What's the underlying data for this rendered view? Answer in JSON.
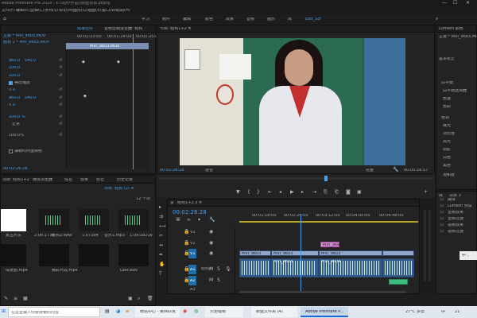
{
  "titlebar": {
    "text": "Adobe Premiere Pro 2020 - E:\\\\动作作品\\\\新建项目.prproj",
    "minimize": "—",
    "maximize": "☐",
    "close": "✕"
  },
  "menubar": [
    "文件(F)",
    "编辑(E)",
    "剪辑(C)",
    "序列(S)",
    "标记(M)",
    "图形(G)",
    "视图(V)",
    "窗口(W)",
    "帮助(H)"
  ],
  "workspaces": [
    "学习",
    "组件",
    "编辑",
    "颜色",
    "效果",
    "音频",
    "图形",
    "库",
    "Edit_Scr"
  ],
  "effect_controls": {
    "tabs": [
      "效果控件",
      "音频剪辑混合器: 结构"
    ],
    "source": "主要 * MVI_9603.MOV",
    "seq": "结构 1 * MVI_9603.MOV",
    "ruler": [
      "00:01:23:00",
      "00:01:24:00",
      "00:01:25:00"
    ],
    "clip_label": "MVI_9603.MOV",
    "values": [
      "960.0",
      "540.0",
      "100.0",
      "100.0",
      "0.0",
      "960.0",
      "540.0",
      "0.0"
    ],
    "uniform": "等比缩放",
    "opacity": "100.0 %",
    "blend": "正常",
    "speed": "100.0%",
    "checkbox": "抽帧时间重映射",
    "time": "00:02:26:28"
  },
  "program": {
    "title": "节目: 结构1+2 ≡",
    "time": "00:02:26:28",
    "fit": "适合",
    "quality": "完整",
    "duration": "00:05:16:57"
  },
  "lumetri": {
    "title": "Lumetri 颜色",
    "sub": "主要 * MVI_9603.MOV",
    "section": "基本校正",
    "items": [
      "白平衡",
      "白平衡选择器",
      "色温",
      "色彩",
      "色调",
      "曝光",
      "对比度",
      "高光",
      "阴影",
      "白色",
      "黑色",
      "饱和度"
    ]
  },
  "project": {
    "tabs": [
      "项目: 结构1+2",
      "媒体浏览器",
      "信息",
      "效果",
      "标记",
      "历史记录"
    ],
    "file_tab": "项目: 结构 (2) ≡",
    "count": "12 个项",
    "items": [
      {
        "name": "复古片头",
        "dur": "2:06:1738"
      },
      {
        "name": "结构2:WAV",
        "dur": "1:07394"
      },
      {
        "name": "音乐1.mp3",
        "dur": "1:09:18216"
      },
      {
        "name": "情景剧.mp4",
        "dur": "4:21"
      },
      {
        "name": "精彩片段.mp4",
        "dur": "2:05"
      },
      {
        "name": "Last.wav",
        "dur": "2:52"
      }
    ]
  },
  "timeline": {
    "tab": "结构1+2.3 ≡",
    "time": "00:02:26:28",
    "ruler": [
      "00:01:18:00",
      "00:02:24:00",
      "00:03:12:00",
      "00:04:00:00",
      "00:04:48:00"
    ],
    "tracks": [
      "V3",
      "V2",
      "V1",
      "A1",
      "A2",
      "A3"
    ],
    "audio_label": "结构2",
    "clips": {
      "v1a": "MVI_9603",
      "v1b": "MVI_9603",
      "v1c": "MVI_9603",
      "v2": "MVI_9603",
      "a1": "MVI_9603",
      "a1b": "MVI_9604"
    }
  },
  "libraries": {
    "tabs": [
      "库",
      "项目 3"
    ],
    "items": [
      "媒体",
      "Lumetri 预设",
      "音频效果",
      "音频过渡",
      "视频效果",
      "视频过渡"
    ]
  },
  "ime": "中 ,",
  "taskbar": {
    "search": "在这里输入你要搜索的内容",
    "apps": [
      "微信中心 - 奥林匹克",
      "火炬视频",
      "新建文件夹 (4)",
      "Adobe Premiere P..."
    ],
    "weather": "27°C 多云",
    "lang": "中",
    "time": "21"
  }
}
